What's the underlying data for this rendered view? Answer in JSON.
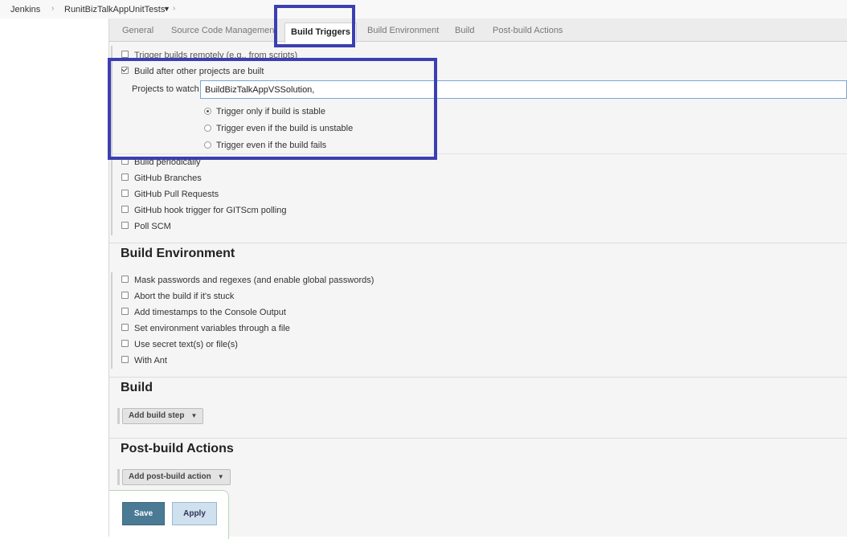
{
  "breadcrumb": {
    "root": "Jenkins",
    "job": "RunitBizTalkAppUnitTests"
  },
  "tabs": [
    {
      "label": "General"
    },
    {
      "label": "Source Code Management"
    },
    {
      "label": "Build Triggers"
    },
    {
      "label": "Build Environment"
    },
    {
      "label": "Build"
    },
    {
      "label": "Post-build Actions"
    }
  ],
  "triggers": {
    "trigger_remotely": "Trigger builds remotely (e.g., from scripts)",
    "build_after": "Build after other projects are built",
    "projects_label": "Projects to watch",
    "projects_value": "BuildBizTalkAppVSSolution, ",
    "radio_stable": "Trigger only if build is stable",
    "radio_unstable": "Trigger even if the build is unstable",
    "radio_fails": "Trigger even if the build fails",
    "build_periodically": "Build periodically",
    "github_branches": "GitHub Branches",
    "github_prs": "GitHub Pull Requests",
    "github_hook": "GitHub hook trigger for GITScm polling",
    "poll_scm": "Poll SCM"
  },
  "build_env": {
    "title": "Build Environment",
    "items": [
      "Mask passwords and regexes (and enable global passwords)",
      "Abort the build if it's stuck",
      "Add timestamps to the Console Output",
      "Set environment variables through a file",
      "Use secret text(s) or file(s)",
      "With Ant"
    ]
  },
  "build": {
    "title": "Build",
    "add_step": "Add build step"
  },
  "post_build": {
    "title": "Post-build Actions",
    "add_action": "Add post-build action"
  },
  "footer": {
    "save": "Save",
    "apply": "Apply"
  },
  "colors": {
    "highlight": "#3c3fb0",
    "save_bg": "#4b7a94",
    "apply_bg": "#cfe0ee"
  }
}
